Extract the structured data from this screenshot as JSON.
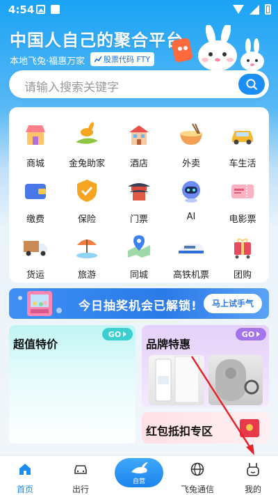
{
  "status_bar": {
    "time": "4:54"
  },
  "header": {
    "title": "中国人自己的聚合平台",
    "subtitle": "本地飞兔·福惠万家",
    "stock_label": "股票代码 FTY"
  },
  "search": {
    "placeholder": "请输入搜索关键字"
  },
  "services": [
    {
      "label": "商城",
      "icon": "shop-icon"
    },
    {
      "label": "金兔助家",
      "icon": "rabbit-hand-icon"
    },
    {
      "label": "酒店",
      "icon": "hotel-icon"
    },
    {
      "label": "外卖",
      "icon": "noodle-bowl-icon"
    },
    {
      "label": "车生活",
      "icon": "car-icon"
    },
    {
      "label": "缴费",
      "icon": "wallet-icon"
    },
    {
      "label": "保险",
      "icon": "shield-icon"
    },
    {
      "label": "门票",
      "icon": "pagoda-icon"
    },
    {
      "label": "AI",
      "icon": "robot-icon"
    },
    {
      "label": "电影票",
      "icon": "movie-ticket-icon"
    },
    {
      "label": "货运",
      "icon": "truck-icon"
    },
    {
      "label": "旅游",
      "icon": "beach-umbrella-icon"
    },
    {
      "label": "同城",
      "icon": "map-pin-icon"
    },
    {
      "label": "高铁机票",
      "icon": "train-icon"
    },
    {
      "label": "团购",
      "icon": "gift-cart-icon"
    }
  ],
  "banner": {
    "text": "今日抽奖机会已解锁!",
    "button": "马上试手气"
  },
  "promos": {
    "left": {
      "title": "超值特价",
      "go": "GO"
    },
    "right_top": {
      "title": "品牌特惠",
      "go": "GO"
    },
    "right_bottom": {
      "title": "红包抵扣专区"
    }
  },
  "tabbar": {
    "items": [
      {
        "label": "首页",
        "icon": "home-icon"
      },
      {
        "label": "出行",
        "icon": "car-front-icon"
      },
      {
        "label": "自营",
        "icon": "rabbit-logo-icon"
      },
      {
        "label": "飞兔通信",
        "icon": "globe-icon"
      },
      {
        "label": "我的",
        "icon": "bunny-face-icon"
      }
    ],
    "active_index": 0
  },
  "colors": {
    "primary": "#1a8cf0",
    "teal": "#3ccfd2",
    "purple": "#a474ea"
  }
}
